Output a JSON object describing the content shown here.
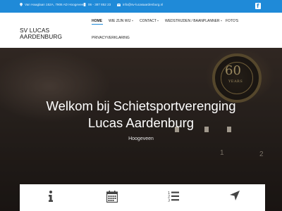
{
  "topbar": {
    "address": "Van Haaglaan 152A, 7906 AD Hoogeveen",
    "phone": "06 - 387 852 23",
    "email": "info@sv-lucasaardenburg.nl",
    "social_icon": "facebook-icon"
  },
  "brand": {
    "line1": "SV LUCAS",
    "line2": "AARDENBURG"
  },
  "nav": {
    "home": "HOME",
    "about": "WIE ZIJN WIJ",
    "contact": "CONTACT",
    "competitions": "WEDSTRIJDEN / BAANPLANNER",
    "photos": "FOTO'S",
    "privacy": "PRIVACYVERKLARING"
  },
  "hero": {
    "title_line1": "Welkom bij Schietsportverenging",
    "title_line2": "Lucas Aardenburg",
    "subtitle": "Hoogeveen",
    "lane_numbers": [
      "1",
      "2"
    ],
    "medal_number": "60",
    "medal_text": "YEARS"
  },
  "features": [
    {
      "icon": "info-icon"
    },
    {
      "icon": "calendar-icon"
    },
    {
      "icon": "numbered-list-icon"
    },
    {
      "icon": "navigation-arrow-icon"
    }
  ],
  "colors": {
    "accent": "#1f8ad8"
  }
}
